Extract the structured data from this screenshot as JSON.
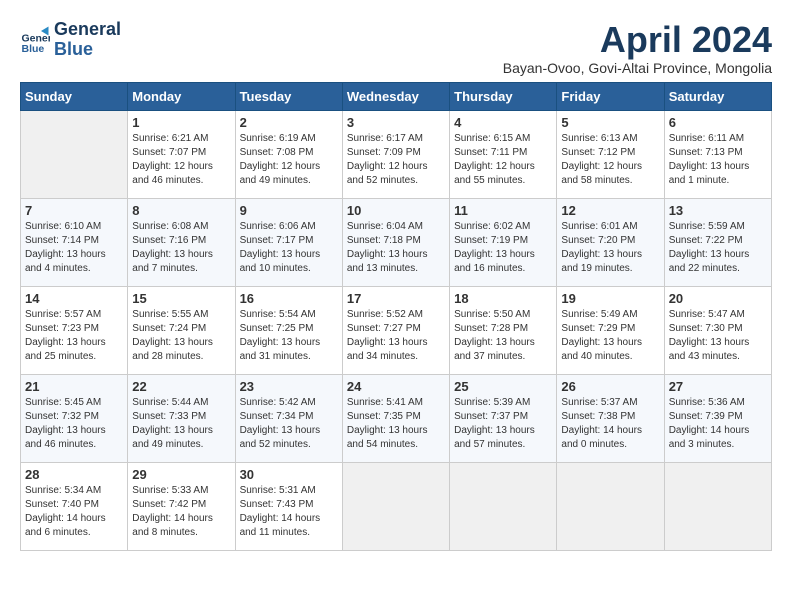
{
  "header": {
    "logo_line1": "General",
    "logo_line2": "Blue",
    "month_title": "April 2024",
    "location": "Bayan-Ovoo, Govi-Altai Province, Mongolia"
  },
  "weekdays": [
    "Sunday",
    "Monday",
    "Tuesday",
    "Wednesday",
    "Thursday",
    "Friday",
    "Saturday"
  ],
  "weeks": [
    [
      {
        "day": "",
        "info": ""
      },
      {
        "day": "1",
        "info": "Sunrise: 6:21 AM\nSunset: 7:07 PM\nDaylight: 12 hours\nand 46 minutes."
      },
      {
        "day": "2",
        "info": "Sunrise: 6:19 AM\nSunset: 7:08 PM\nDaylight: 12 hours\nand 49 minutes."
      },
      {
        "day": "3",
        "info": "Sunrise: 6:17 AM\nSunset: 7:09 PM\nDaylight: 12 hours\nand 52 minutes."
      },
      {
        "day": "4",
        "info": "Sunrise: 6:15 AM\nSunset: 7:11 PM\nDaylight: 12 hours\nand 55 minutes."
      },
      {
        "day": "5",
        "info": "Sunrise: 6:13 AM\nSunset: 7:12 PM\nDaylight: 12 hours\nand 58 minutes."
      },
      {
        "day": "6",
        "info": "Sunrise: 6:11 AM\nSunset: 7:13 PM\nDaylight: 13 hours\nand 1 minute."
      }
    ],
    [
      {
        "day": "7",
        "info": "Sunrise: 6:10 AM\nSunset: 7:14 PM\nDaylight: 13 hours\nand 4 minutes."
      },
      {
        "day": "8",
        "info": "Sunrise: 6:08 AM\nSunset: 7:16 PM\nDaylight: 13 hours\nand 7 minutes."
      },
      {
        "day": "9",
        "info": "Sunrise: 6:06 AM\nSunset: 7:17 PM\nDaylight: 13 hours\nand 10 minutes."
      },
      {
        "day": "10",
        "info": "Sunrise: 6:04 AM\nSunset: 7:18 PM\nDaylight: 13 hours\nand 13 minutes."
      },
      {
        "day": "11",
        "info": "Sunrise: 6:02 AM\nSunset: 7:19 PM\nDaylight: 13 hours\nand 16 minutes."
      },
      {
        "day": "12",
        "info": "Sunrise: 6:01 AM\nSunset: 7:20 PM\nDaylight: 13 hours\nand 19 minutes."
      },
      {
        "day": "13",
        "info": "Sunrise: 5:59 AM\nSunset: 7:22 PM\nDaylight: 13 hours\nand 22 minutes."
      }
    ],
    [
      {
        "day": "14",
        "info": "Sunrise: 5:57 AM\nSunset: 7:23 PM\nDaylight: 13 hours\nand 25 minutes."
      },
      {
        "day": "15",
        "info": "Sunrise: 5:55 AM\nSunset: 7:24 PM\nDaylight: 13 hours\nand 28 minutes."
      },
      {
        "day": "16",
        "info": "Sunrise: 5:54 AM\nSunset: 7:25 PM\nDaylight: 13 hours\nand 31 minutes."
      },
      {
        "day": "17",
        "info": "Sunrise: 5:52 AM\nSunset: 7:27 PM\nDaylight: 13 hours\nand 34 minutes."
      },
      {
        "day": "18",
        "info": "Sunrise: 5:50 AM\nSunset: 7:28 PM\nDaylight: 13 hours\nand 37 minutes."
      },
      {
        "day": "19",
        "info": "Sunrise: 5:49 AM\nSunset: 7:29 PM\nDaylight: 13 hours\nand 40 minutes."
      },
      {
        "day": "20",
        "info": "Sunrise: 5:47 AM\nSunset: 7:30 PM\nDaylight: 13 hours\nand 43 minutes."
      }
    ],
    [
      {
        "day": "21",
        "info": "Sunrise: 5:45 AM\nSunset: 7:32 PM\nDaylight: 13 hours\nand 46 minutes."
      },
      {
        "day": "22",
        "info": "Sunrise: 5:44 AM\nSunset: 7:33 PM\nDaylight: 13 hours\nand 49 minutes."
      },
      {
        "day": "23",
        "info": "Sunrise: 5:42 AM\nSunset: 7:34 PM\nDaylight: 13 hours\nand 52 minutes."
      },
      {
        "day": "24",
        "info": "Sunrise: 5:41 AM\nSunset: 7:35 PM\nDaylight: 13 hours\nand 54 minutes."
      },
      {
        "day": "25",
        "info": "Sunrise: 5:39 AM\nSunset: 7:37 PM\nDaylight: 13 hours\nand 57 minutes."
      },
      {
        "day": "26",
        "info": "Sunrise: 5:37 AM\nSunset: 7:38 PM\nDaylight: 14 hours\nand 0 minutes."
      },
      {
        "day": "27",
        "info": "Sunrise: 5:36 AM\nSunset: 7:39 PM\nDaylight: 14 hours\nand 3 minutes."
      }
    ],
    [
      {
        "day": "28",
        "info": "Sunrise: 5:34 AM\nSunset: 7:40 PM\nDaylight: 14 hours\nand 6 minutes."
      },
      {
        "day": "29",
        "info": "Sunrise: 5:33 AM\nSunset: 7:42 PM\nDaylight: 14 hours\nand 8 minutes."
      },
      {
        "day": "30",
        "info": "Sunrise: 5:31 AM\nSunset: 7:43 PM\nDaylight: 14 hours\nand 11 minutes."
      },
      {
        "day": "",
        "info": ""
      },
      {
        "day": "",
        "info": ""
      },
      {
        "day": "",
        "info": ""
      },
      {
        "day": "",
        "info": ""
      }
    ]
  ]
}
